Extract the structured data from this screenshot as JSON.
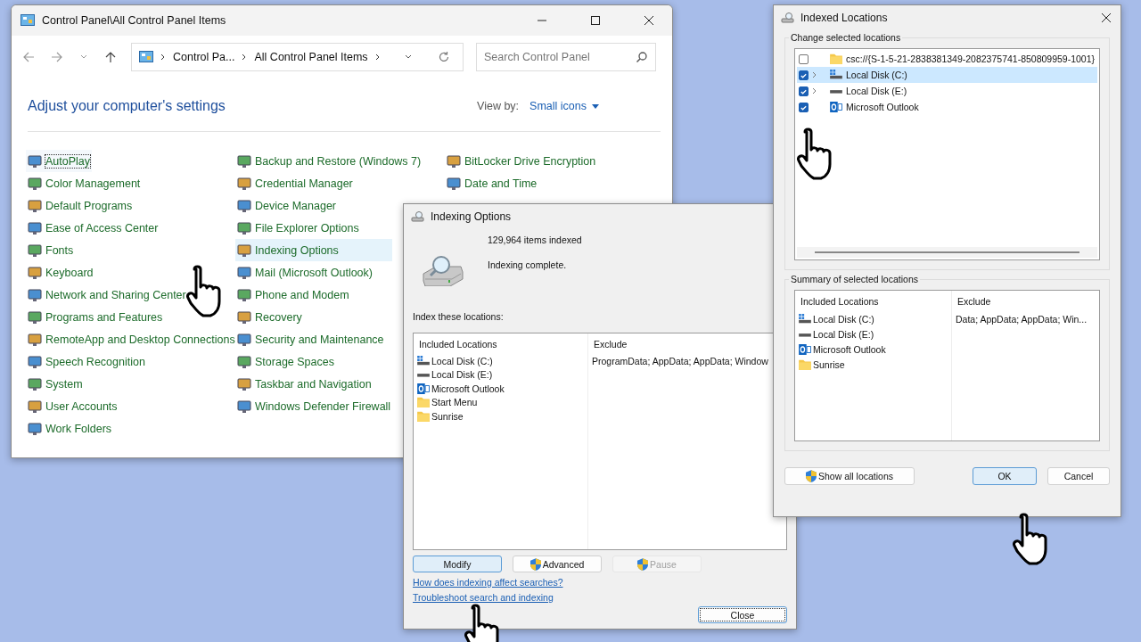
{
  "control_panel": {
    "title": "Control Panel\\All Control Panel Items",
    "breadcrumbs": [
      "Control Pa...",
      "All Control Panel Items"
    ],
    "search": {
      "placeholder": "Search Control Panel"
    },
    "heading": "Adjust your computer's settings",
    "view_by": {
      "label": "View by:",
      "value": "Small icons"
    },
    "columns": [
      [
        {
          "label": "AutoPlay",
          "selected": false,
          "focused": true
        },
        {
          "label": "Color Management",
          "selected": false,
          "focused": false
        },
        {
          "label": "Default Programs",
          "selected": false,
          "focused": false
        },
        {
          "label": "Ease of Access Center",
          "selected": false,
          "focused": false
        },
        {
          "label": "Fonts",
          "selected": false,
          "focused": false
        },
        {
          "label": "Keyboard",
          "selected": false,
          "focused": false
        },
        {
          "label": "Network and Sharing Center",
          "selected": false,
          "focused": false
        },
        {
          "label": "Programs and Features",
          "selected": false,
          "focused": false
        },
        {
          "label": "RemoteApp and Desktop Connections",
          "selected": false,
          "focused": false
        },
        {
          "label": "Speech Recognition",
          "selected": false,
          "focused": false
        },
        {
          "label": "System",
          "selected": false,
          "focused": false
        },
        {
          "label": "User Accounts",
          "selected": false,
          "focused": false
        },
        {
          "label": "Work Folders",
          "selected": false,
          "focused": false
        }
      ],
      [
        {
          "label": "Backup and Restore (Windows 7)",
          "selected": false,
          "focused": false
        },
        {
          "label": "Credential Manager",
          "selected": false,
          "focused": false
        },
        {
          "label": "Device Manager",
          "selected": false,
          "focused": false
        },
        {
          "label": "File Explorer Options",
          "selected": false,
          "focused": false
        },
        {
          "label": "Indexing Options",
          "selected": true,
          "focused": false
        },
        {
          "label": "Mail (Microsoft Outlook)",
          "selected": false,
          "focused": false
        },
        {
          "label": "Phone and Modem",
          "selected": false,
          "focused": false
        },
        {
          "label": "Recovery",
          "selected": false,
          "focused": false
        },
        {
          "label": "Security and Maintenance",
          "selected": false,
          "focused": false
        },
        {
          "label": "Storage Spaces",
          "selected": false,
          "focused": false
        },
        {
          "label": "Taskbar and Navigation",
          "selected": false,
          "focused": false
        },
        {
          "label": "Windows Defender Firewall",
          "selected": false,
          "focused": false
        }
      ],
      [
        {
          "label": "BitLocker Drive Encryption",
          "selected": false,
          "focused": false
        },
        {
          "label": "Date and Time",
          "selected": false,
          "focused": false
        }
      ]
    ]
  },
  "indexing_options": {
    "title": "Indexing Options",
    "items_indexed": "129,964 items indexed",
    "status": "Indexing complete.",
    "locations_label": "Index these locations:",
    "columns": [
      "Included Locations",
      "Exclude"
    ],
    "locations": [
      {
        "name": "Local Disk (C:)",
        "kind": "system-drive",
        "exclude": "ProgramData; AppData; AppData; Window"
      },
      {
        "name": "Local Disk (E:)",
        "kind": "drive"
      },
      {
        "name": "Microsoft Outlook",
        "kind": "outlook"
      },
      {
        "name": "Start Menu",
        "kind": "folder"
      },
      {
        "name": "Sunrise",
        "kind": "folder"
      }
    ],
    "buttons": [
      {
        "label": "Modify",
        "shield": false,
        "disabled": false,
        "highlighted": true
      },
      {
        "label": "Advanced",
        "shield": true,
        "disabled": false,
        "highlighted": false
      },
      {
        "label": "Pause",
        "shield": true,
        "disabled": true,
        "highlighted": false
      }
    ],
    "links": [
      "How does indexing affect searches?",
      "Troubleshoot search and indexing"
    ],
    "close_button": "Close"
  },
  "indexed_locations": {
    "title": "Indexed Locations",
    "change_label": "Change selected locations",
    "tree": [
      {
        "name": "csc://{S-1-5-21-2838381349-2082375741-850809959-1001}",
        "kind": "folder",
        "checked": false,
        "expandable": false,
        "selected": false
      },
      {
        "name": "Local Disk (C:)",
        "kind": "system-drive",
        "checked": true,
        "expandable": true,
        "selected": true
      },
      {
        "name": "Local Disk (E:)",
        "kind": "drive",
        "checked": true,
        "expandable": true,
        "selected": false
      },
      {
        "name": "Microsoft Outlook",
        "kind": "outlook",
        "checked": true,
        "expandable": false,
        "selected": false
      }
    ],
    "summary_label": "Summary of selected locations",
    "columns": [
      "Included Locations",
      "Exclude"
    ],
    "summary": [
      {
        "name": "Local Disk (C:)",
        "kind": "system-drive",
        "exclude": "Data; AppData; AppData; Win..."
      },
      {
        "name": "Local Disk (E:)",
        "kind": "drive"
      },
      {
        "name": "Microsoft Outlook",
        "kind": "outlook"
      },
      {
        "name": "Sunrise",
        "kind": "folder"
      }
    ],
    "show_all_button": "Show all locations",
    "ok_button": "OK",
    "cancel_button": "Cancel"
  }
}
